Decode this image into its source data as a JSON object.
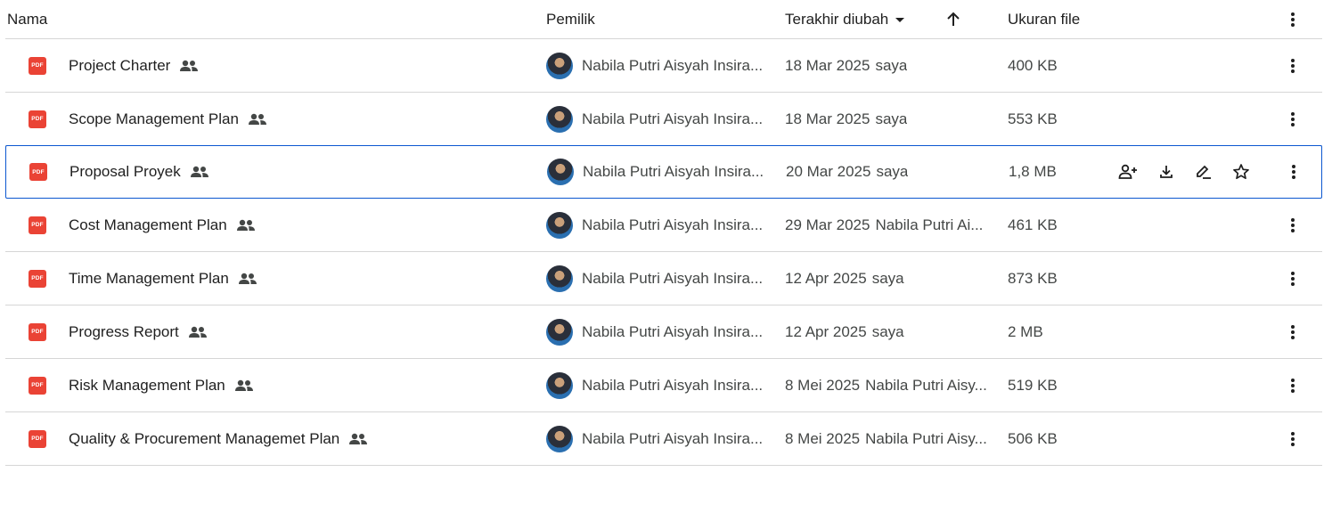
{
  "header": {
    "name": "Nama",
    "owner": "Pemilik",
    "modified": "Terakhir diubah",
    "size": "Ukuran file",
    "sort_icon": "arrow-up-icon",
    "dropdown_icon": "caret-down-icon"
  },
  "file_icon_label": "PDF",
  "rows": [
    {
      "name": "Project Charter",
      "owner": "Nabila Putri Aisyah Insira...",
      "modified_date": "18 Mar 2025",
      "modified_by": "saya",
      "size": "400 KB"
    },
    {
      "name": "Scope Management Plan",
      "owner": "Nabila Putri Aisyah Insira...",
      "modified_date": "18 Mar 2025",
      "modified_by": "saya",
      "size": "553 KB"
    },
    {
      "name": "Proposal Proyek",
      "owner": "Nabila Putri Aisyah Insira...",
      "modified_date": "20 Mar 2025",
      "modified_by": "saya",
      "size": "1,8 MB"
    },
    {
      "name": "Cost Management Plan",
      "owner": "Nabila Putri Aisyah Insira...",
      "modified_date": "29 Mar 2025",
      "modified_by": "Nabila Putri Ai...",
      "size": "461 KB"
    },
    {
      "name": "Time Management Plan",
      "owner": "Nabila Putri Aisyah Insira...",
      "modified_date": "12 Apr 2025",
      "modified_by": "saya",
      "size": "873 KB"
    },
    {
      "name": "Progress Report",
      "owner": "Nabila Putri Aisyah Insira...",
      "modified_date": "12 Apr 2025",
      "modified_by": "saya",
      "size": "2 MB"
    },
    {
      "name": "Risk Management Plan",
      "owner": "Nabila Putri Aisyah Insira...",
      "modified_date": "8 Mei 2025",
      "modified_by": "Nabila Putri Aisy...",
      "size": "519 KB"
    },
    {
      "name": "Quality & Procurement Managemet Plan",
      "owner": "Nabila Putri Aisyah Insira...",
      "modified_date": "8 Mei 2025",
      "modified_by": "Nabila Putri Aisy...",
      "size": "506 KB"
    }
  ],
  "selected_row_actions": [
    "share-icon",
    "download-icon",
    "rename-icon",
    "star-icon"
  ],
  "colors": {
    "pdf": "#ea4335",
    "selection": "#0b57d0",
    "divider": "#d6d6d6"
  }
}
